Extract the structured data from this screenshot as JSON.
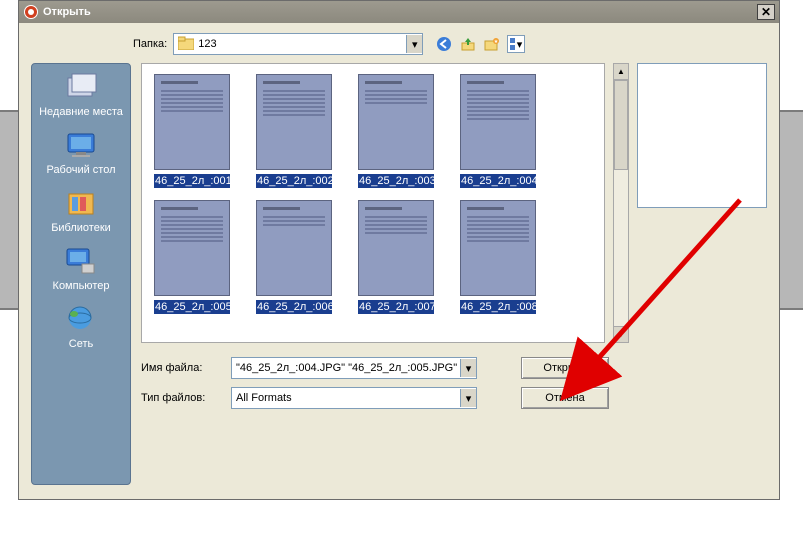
{
  "dialog": {
    "title": "Открыть",
    "folder_label": "Папка:",
    "folder_value": "123",
    "filename_label": "Имя файла:",
    "filename_value": "\"46_25_2л_:004.JPG\" \"46_25_2л_:005.JPG\"",
    "filetype_label": "Тип файлов:",
    "filetype_value": "All Formats",
    "open_button": "Открыть",
    "cancel_button": "Отмена"
  },
  "sidebar": [
    {
      "label": "Недавние места"
    },
    {
      "label": "Рабочий стол"
    },
    {
      "label": "Библиотеки"
    },
    {
      "label": "Компьютер"
    },
    {
      "label": "Сеть"
    }
  ],
  "files": [
    {
      "name": "46_25_2л_:001"
    },
    {
      "name": "46_25_2л_:002"
    },
    {
      "name": "46_25_2л_:003"
    },
    {
      "name": "46_25_2л_:004"
    },
    {
      "name": "46_25_2л_:005"
    },
    {
      "name": "46_25_2л_:006"
    },
    {
      "name": "46_25_2л_:007"
    },
    {
      "name": "46_25_2л_:008"
    }
  ]
}
